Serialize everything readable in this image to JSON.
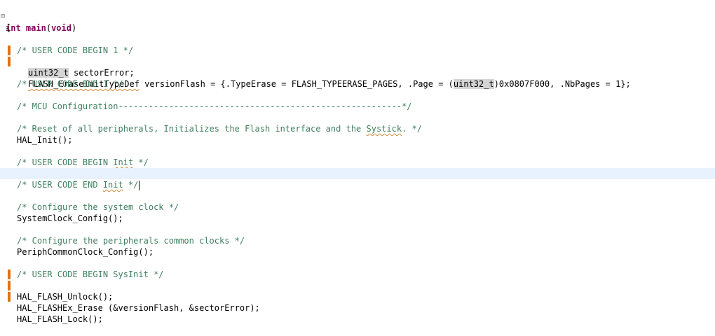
{
  "editor": {
    "signature": {
      "return_type": "int",
      "name": "main",
      "params_open": "(",
      "params": "void",
      "params_close": ")"
    },
    "open_brace": "{",
    "lines": {
      "ucb1": "/* USER CODE BEGIN 1 */",
      "decl1_type": "uint32_t",
      "decl1_rest": " sectorError;",
      "decl2_type": "FLASH_EraseInitTypeDef",
      "decl2_mid": " versionFlash = {.TypeErase = FLASH_TYPEERASE_PAGES, .Page = (",
      "decl2_cast": "uint32_t",
      "decl2_end": ")0x0807F000, .NbPages = 1};",
      "uce1": "/* USER CODE END 1 */",
      "mcu_cfg": "/* MCU Configuration--------------------------------------------------------*/",
      "reset_a": "/* Reset of all peripherals, Initializes the Flash interface and the ",
      "reset_b": "Systick",
      "reset_c": ". */",
      "hal_init": "HAL_Init();",
      "ucb_init_a": "/* USER CODE BEGIN ",
      "ucb_init_b": "Init",
      "ucb_init_c": " */",
      "uce_init_a": "/* USER CODE END ",
      "uce_init_b": "Init",
      "uce_init_c": " */",
      "cfg_clock_comment": "/* Configure the system clock */",
      "sysclock_call": "SystemClock_Config();",
      "cfg_periph_comment": "/* Configure the peripherals common clocks */",
      "periph_call": "PeriphCommonClock_Config();",
      "ucb_sysinit": "/* USER CODE BEGIN SysInit */",
      "flash_unlock": "HAL_FLASH_Unlock();",
      "flash_erase": "HAL_FLASHEx_Erase (&versionFlash, &sectorError);",
      "flash_lock": "HAL_FLASH_Lock();"
    },
    "colors": {
      "keyword": "#7f0055",
      "comment": "#3f7f5f",
      "change_marker": "#e07310",
      "current_line": "#e8f2fe"
    },
    "icons": {
      "fold": "fold-collapse-icon",
      "marker": "change-marker"
    }
  }
}
